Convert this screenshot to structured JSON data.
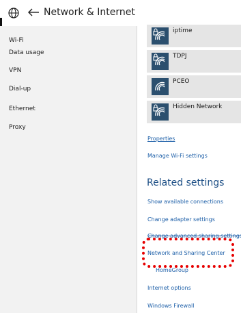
{
  "header": {
    "title": "Network & Internet"
  },
  "sidebar": {
    "items": [
      {
        "label": "Wi-Fi"
      },
      {
        "label": "Data usage"
      },
      {
        "label": "VPN"
      },
      {
        "label": "Dial-up"
      },
      {
        "label": "Ethernet"
      },
      {
        "label": "Proxy"
      }
    ]
  },
  "wifi": {
    "networks": [
      {
        "name": "iptime",
        "icon": "wifi-secured-icon"
      },
      {
        "name": "TDPJ",
        "icon": "wifi-secured-icon"
      },
      {
        "name": "PCEO",
        "icon": "wifi-open-icon"
      },
      {
        "name": "Hidden Network",
        "icon": "wifi-secured-icon"
      }
    ],
    "properties_link": "Properties",
    "manage_link": "Manage Wi-Fi settings"
  },
  "related": {
    "title": "Related settings",
    "links": [
      {
        "label": "Show available connections"
      },
      {
        "label": "Change adapter settings"
      },
      {
        "label": "Change advanced sharing settings"
      },
      {
        "label": "Network and Sharing Center"
      },
      {
        "label": "HomeGroup"
      },
      {
        "label": "Internet options"
      },
      {
        "label": "Windows Firewall"
      }
    ]
  },
  "colors": {
    "accent": "#1d5fa8",
    "wifi_tile": "#2b4f6e",
    "highlight": "#e60000",
    "sidebar_bg": "#f2f2f2"
  }
}
